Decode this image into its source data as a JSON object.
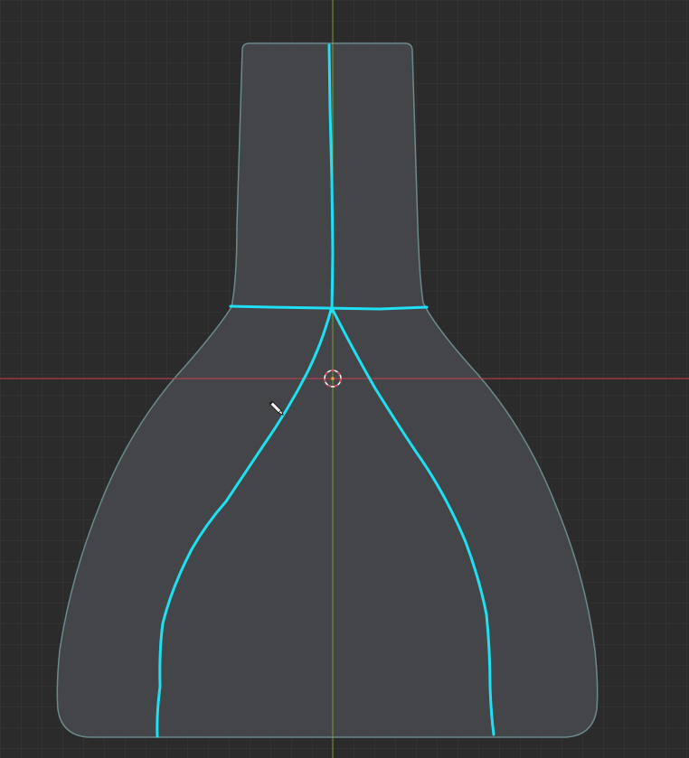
{
  "app": {
    "view": "viewport-2d"
  },
  "colors": {
    "background": "#2b2b2b",
    "grid_minor": "#3a3a3a",
    "grid_major": "#444444",
    "mesh_fill": "#4a4d52",
    "mesh_outline": "#6a8a8c",
    "stroke": "#1fe0f2",
    "x_axis": "#c8404e",
    "y_axis": "#7a9a3a",
    "cursor_ring_red": "#e0455a",
    "cursor_ring_white": "#f0f0f0",
    "cursor_dot": "#f0a040"
  },
  "icons": {
    "cursor": "3d-cursor-icon",
    "tool": "draw-pencil-icon"
  }
}
